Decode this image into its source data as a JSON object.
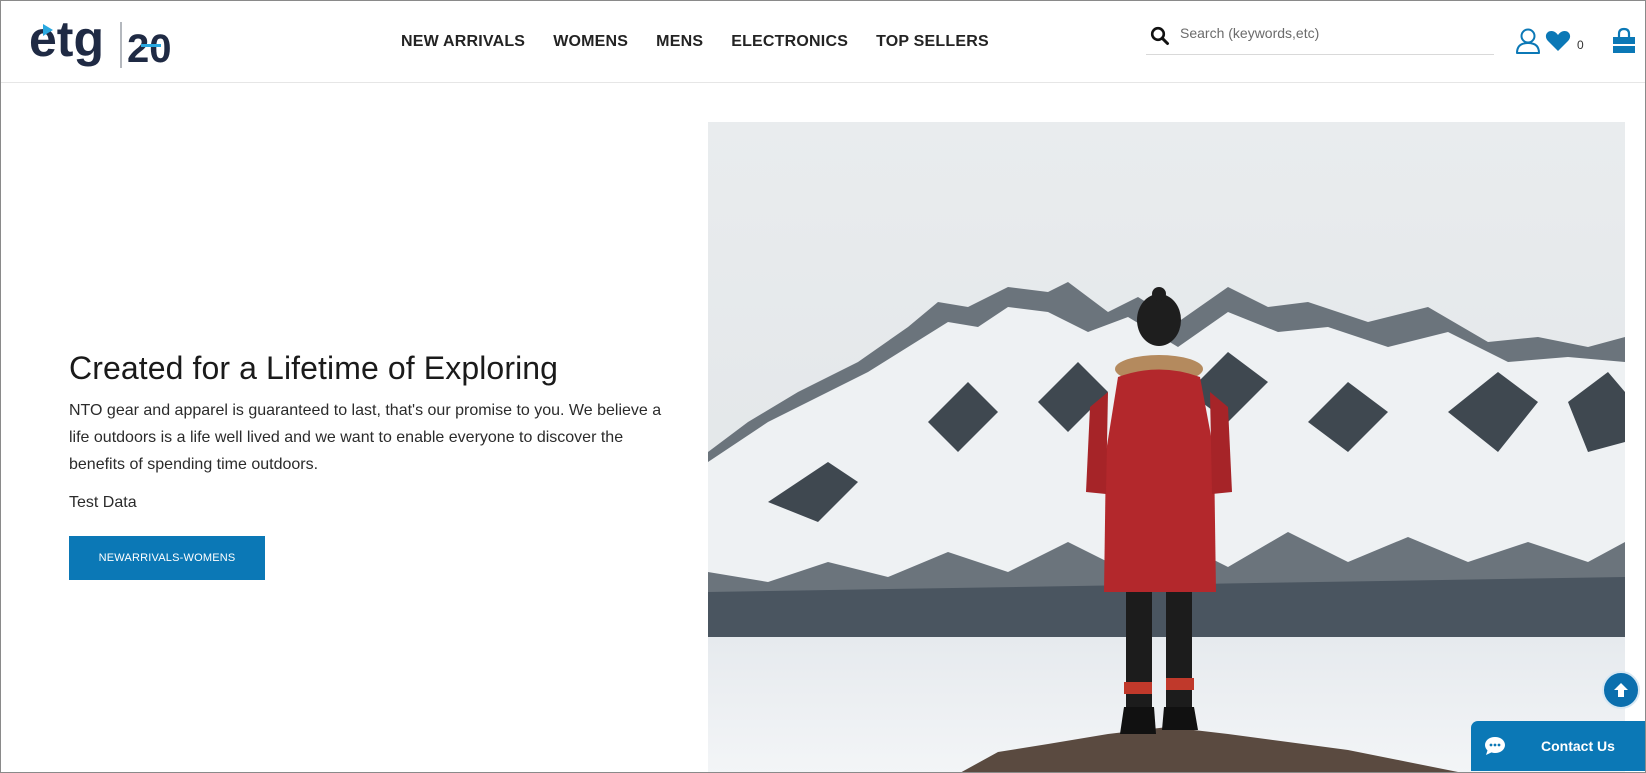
{
  "brand": {
    "logo_text": "etg",
    "logo_number": "20",
    "colors": {
      "primary": "#0b78b6",
      "logo_dark": "#1f2a44",
      "logo_accent": "#29a8e0"
    }
  },
  "nav": {
    "items": [
      {
        "label": "NEW ARRIVALS"
      },
      {
        "label": "WOMENS"
      },
      {
        "label": "MENS"
      },
      {
        "label": "ELECTRONICS"
      },
      {
        "label": "TOP SELLERS"
      }
    ]
  },
  "search": {
    "placeholder": "Search (keywords,etc)",
    "value": "",
    "icon": "search-icon"
  },
  "header_icons": {
    "account_icon": "user-icon",
    "wishlist_icon": "heart-icon",
    "wishlist_count": "0",
    "cart_icon": "shopping-bag-icon"
  },
  "hero": {
    "title": "Created for a Lifetime of Exploring",
    "description": "NTO gear and apparel is guaranteed to last, that's our promise to you. We believe a life outdoors is a life well lived and we want to enable everyone to discover the benefits of spending time outdoors.",
    "note": "Test Data",
    "button_label": "NEWARRIVALS-WOMENS"
  },
  "floating": {
    "scroll_top_icon": "arrow-up-icon",
    "contact_label": "Contact Us",
    "contact_icon": "chat-icon"
  }
}
